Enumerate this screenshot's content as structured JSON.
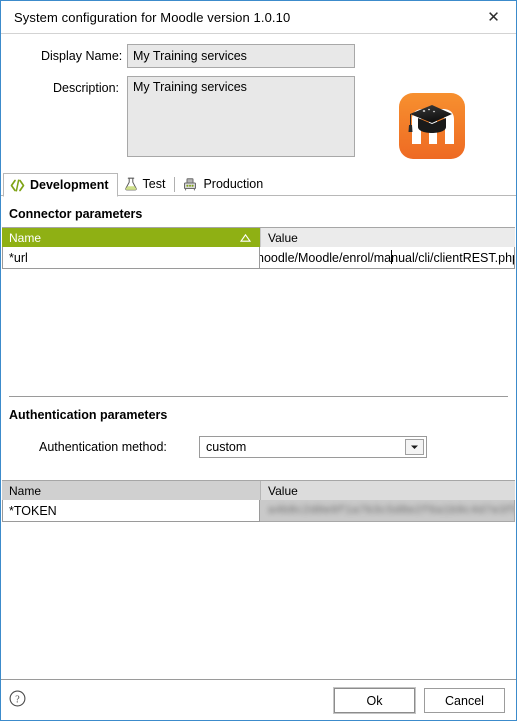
{
  "window": {
    "title": "System configuration for Moodle version 1.0.10",
    "close_icon": "close-icon"
  },
  "form": {
    "display_name": {
      "label": "Display Name:",
      "value": "My Training services"
    },
    "description": {
      "label": "Description:",
      "value": "My Training services"
    },
    "logo_alt": "moodle-logo"
  },
  "tabs": [
    {
      "label": "Development",
      "icon": "code-icon",
      "active": true
    },
    {
      "label": "Test",
      "icon": "flask-icon",
      "active": false
    },
    {
      "label": "Production",
      "icon": "server-icon",
      "active": false
    }
  ],
  "connector": {
    "section_title": "Connector parameters",
    "columns": [
      "Name",
      "Value"
    ],
    "sort_indicator": "sort-ascending-icon",
    "rows": [
      {
        "name": "*url",
        "value_prefix": "noodle/Moodle/enrol/ma",
        "value_suffix": "nual/cli/clientREST.php"
      }
    ]
  },
  "authentication": {
    "section_title": "Authentication parameters",
    "method": {
      "label": "Authentication method:",
      "value": "custom",
      "dropdown_icon": "chevron-down-icon"
    },
    "columns": [
      "Name",
      "Value"
    ],
    "rows": [
      {
        "name": "*TOKEN",
        "value": "a4b8c2d0e9f1a7b3c5d8e2f6a1b9c4d7e3f0a8b2"
      }
    ]
  },
  "footer": {
    "help_icon": "help-icon",
    "ok_label": "Ok",
    "cancel_label": "Cancel"
  },
  "colors": {
    "window_border": "#3c8bcb",
    "header_green": "#8fb014",
    "field_bg": "#e8e8e8",
    "moodle_orange": "#f48024"
  }
}
